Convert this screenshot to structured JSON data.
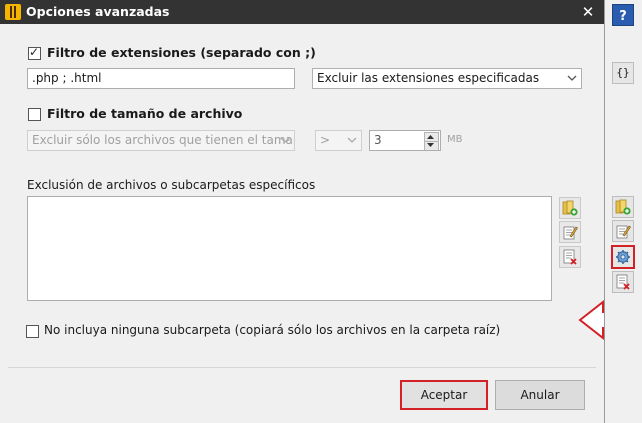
{
  "dialog": {
    "title": "Opciones avanzadas",
    "close_label": "✕"
  },
  "extension_filter": {
    "label": "Filtro de extensiones (separado con ;)",
    "checked": true,
    "value": ".php ; .html",
    "mode_selected": "Excluir las extensiones especificadas"
  },
  "size_filter": {
    "label": "Filtro de tamaño de archivo",
    "checked": false,
    "mode_selected": "Excluir sólo los archivos que tienen el tamaño",
    "operator_selected": ">",
    "size_value": "3",
    "unit": "MB"
  },
  "exclusion": {
    "label": "Exclusión de archivos o subcarpetas específicos",
    "items": []
  },
  "no_subfolders": {
    "label": "No incluya ninguna subcarpeta (copiará sólo los archivos en la carpeta raíz)",
    "checked": false
  },
  "buttons": {
    "accept": "Aceptar",
    "cancel": "Anular"
  },
  "sidebar": {
    "braces_label": "{}"
  },
  "colors": {
    "titlebar": "#333333",
    "highlight": "#d42027",
    "accent_blue": "#2a5db0"
  }
}
